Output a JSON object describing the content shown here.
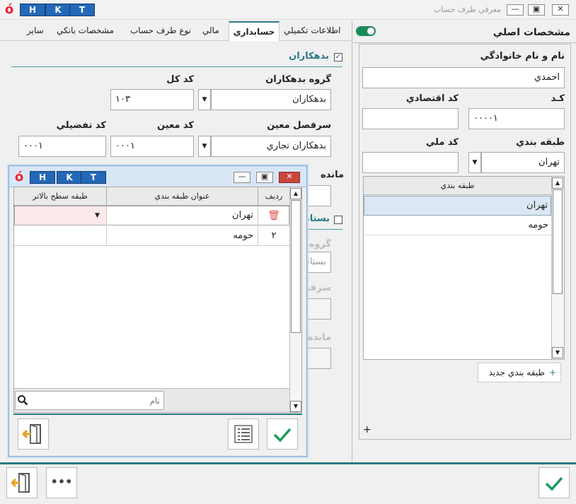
{
  "window": {
    "title": "معرفي طرف حساب",
    "logo": "ó",
    "hkt": [
      "H",
      "K",
      "T"
    ],
    "controls": {
      "minimize": "—",
      "maximize": "▣",
      "close": "✕"
    }
  },
  "right": {
    "section_title": "مشخصات اصلي",
    "name_label": "نام و نام خانوادگي",
    "name_value": "احمدي",
    "code_label": "كـد",
    "code_value": "۰۰۰۰۱",
    "econ_label": "كد اقتصادي",
    "econ_value": "",
    "category_label": "طبقه بندي",
    "category_value": "تهران",
    "national_label": "كد ملي",
    "national_value": "",
    "grid_header": "طبقه بندي",
    "grid_rows": [
      "تهران",
      "حومه"
    ],
    "new_category": "طبقه بندي جديد",
    "plus": "+"
  },
  "tabs": [
    "اطلاعات تكميلي",
    "حسابداري",
    "مالي",
    "نوع طرف حساب",
    "مشخصات بانكي",
    "ساير"
  ],
  "debtors": {
    "title": "بدهكاران",
    "group_label": "گروه بدهكاران",
    "group_value": "بدهكاران",
    "kol_label": "كد كل",
    "kol_value": "۱۰۳",
    "sarfasl_label": "سرفصل معين",
    "sarfasl_value": "بدهكاران تجاري",
    "moein_label": "كد معين",
    "moein_value": "۰۰۰۱",
    "tafsili_label": "كد تفضيلي",
    "tafsili_value": "۰۰۰۱",
    "mande_label": "مانده"
  },
  "creditors": {
    "title": "بستانكاران",
    "group_label": "گروه بستانكاران",
    "group_value": "بستانكاران",
    "sarfasl_label": "سرفصل",
    "mande_label": "مانده"
  },
  "dialog": {
    "columns": [
      "رديف",
      "عنوان طبقه بندي",
      "طبقه سطح بالاتر"
    ],
    "rows": [
      {
        "index": "",
        "title": "تهران",
        "parent": ""
      },
      {
        "index": "۲",
        "title": "حومه",
        "parent": ""
      }
    ],
    "search_placeholder": "نام"
  },
  "footer": {
    "more": "•••"
  },
  "colors": {
    "accent": "#2a7a86",
    "ok": "#1a9a5a",
    "exit": "#e8a020",
    "hkt": "#2468b8"
  }
}
